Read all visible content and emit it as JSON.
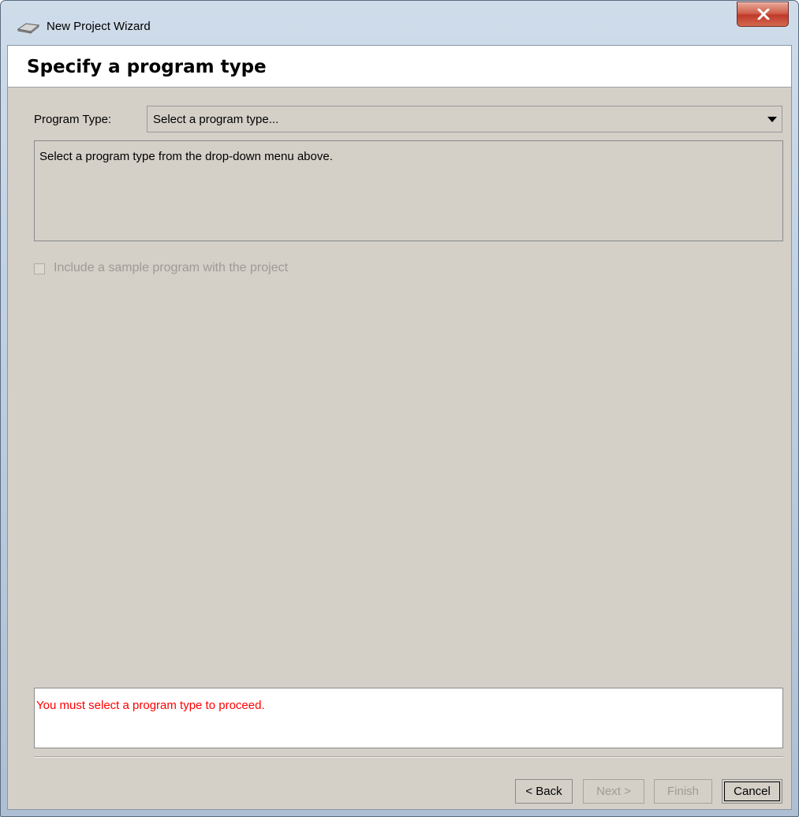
{
  "window": {
    "title": "New Project Wizard",
    "close_label": "X"
  },
  "header": {
    "title": "Specify a program type"
  },
  "program_type": {
    "label": "Program Type:",
    "selected": "Select a program type..."
  },
  "description": {
    "text": "Select a program type from the drop-down menu above."
  },
  "sample": {
    "label": "Include a sample program with the project",
    "checked": false,
    "enabled": false
  },
  "message": {
    "text": "You must select a program type to proceed.",
    "color": "#ff0000"
  },
  "buttons": {
    "back": "< Back",
    "next": "Next >",
    "finish": "Finish",
    "cancel": "Cancel"
  }
}
